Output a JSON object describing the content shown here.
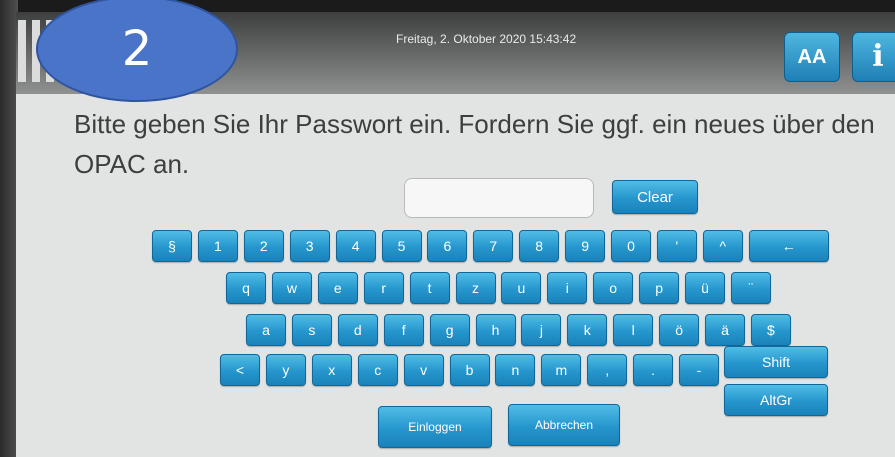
{
  "header": {
    "datetime": "Freitag, 2. Oktober 2020 15:43:42",
    "fontsize_label": "AA",
    "info_label": "i"
  },
  "step_badge": "2",
  "instruction": "Bitte geben Sie Ihr Passwort ein. Fordern Sie ggf. ein neues über den OPAC an.",
  "password_field": {
    "value": ""
  },
  "clear_label": "Clear",
  "keyboard": {
    "row1": [
      "§",
      "1",
      "2",
      "3",
      "4",
      "5",
      "6",
      "7",
      "8",
      "9",
      "0",
      "'",
      "^",
      "←"
    ],
    "row2": [
      "q",
      "w",
      "e",
      "r",
      "t",
      "z",
      "u",
      "i",
      "o",
      "p",
      "ü",
      "¨"
    ],
    "row3": [
      "a",
      "s",
      "d",
      "f",
      "g",
      "h",
      "j",
      "k",
      "l",
      "ö",
      "ä",
      "$"
    ],
    "row4": [
      "<",
      "y",
      "x",
      "c",
      "v",
      "b",
      "n",
      "m",
      ",",
      ".",
      "-"
    ],
    "shift_label": "Shift",
    "altgr_label": "AltGr"
  },
  "actions": {
    "login_label": "Einloggen",
    "cancel_label": "Abbrechen"
  }
}
